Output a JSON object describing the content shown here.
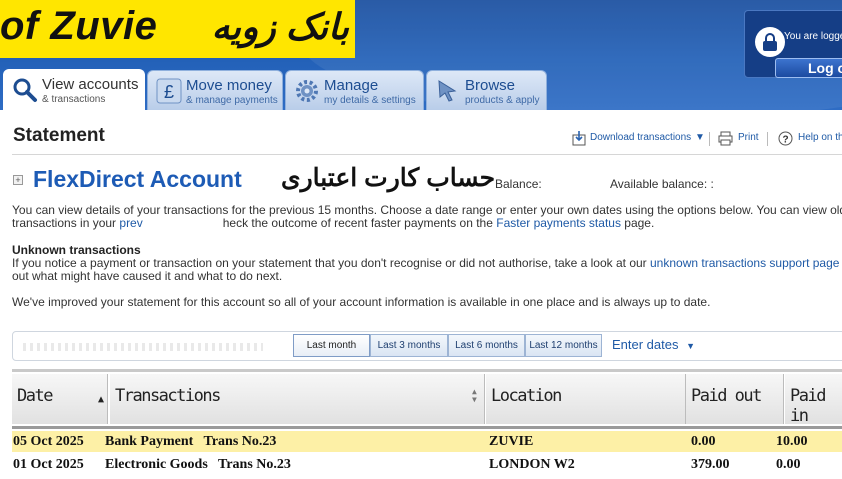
{
  "brand": {
    "name_en": "of Zuvie",
    "name_fa": "بانک زویه"
  },
  "session": {
    "status_text": "You are logge",
    "logout_label": "Log o"
  },
  "tabs": [
    {
      "title": "View accounts",
      "subtitle": "& transactions",
      "icon": "search-icon"
    },
    {
      "title": "Move money",
      "subtitle": "& manage payments",
      "icon": "pound-icon"
    },
    {
      "title": "Manage",
      "subtitle": "my details & settings",
      "icon": "gear-icon"
    },
    {
      "title": "Browse",
      "subtitle": "products & apply",
      "icon": "cursor-icon"
    }
  ],
  "page": {
    "title": "Statement",
    "tools": {
      "download": "Download transactions",
      "print": "Print",
      "help": "Help on th"
    }
  },
  "account": {
    "name": "FlexDirect Account",
    "name_fa": "حساب کارت اعتباری",
    "balance_label": "Balance:",
    "available_label": "Available balance:",
    "available_value": ":"
  },
  "intro": {
    "line1": "You can view details of your transactions for the previous 15 months. Choose a date range or enter your own dates using the options below. You can view older",
    "line2_a": "transactions in your ",
    "line2_link1": "prev",
    "line2_b": "heck the outcome of recent faster payments on the ",
    "line2_link2": "Faster payments status",
    "line2_c": " page."
  },
  "unknown": {
    "heading": "Unknown transactions",
    "line1_a": "If you notice a payment or transaction on your statement that you don't recognise or did not authorise, take a look at our ",
    "line1_link": "unknown transactions support page",
    "line2": "out what might have caused it and what to do next."
  },
  "notice": "We've improved your statement for this account so all of your account information is available in one place and is always up to date.",
  "filters": {
    "ranges": [
      "Last month",
      "Last 3 months",
      "Last 6 months",
      "Last 12 months"
    ],
    "selected": "Last month",
    "enter_dates": "Enter dates"
  },
  "table": {
    "headers": [
      "Date",
      "Transactions",
      "Location",
      "Paid out",
      "Paid in"
    ],
    "rows": [
      {
        "date": "05 Oct 2025",
        "description": "Bank Payment   Trans No.23",
        "location": "ZUVIE",
        "paid_out": "0.00",
        "paid_in": "10.00",
        "highlight": true
      },
      {
        "date": "01 Oct 2025",
        "description": "Electronic Goods   Trans No.23",
        "location": "LONDON W2",
        "paid_out": "379.00",
        "paid_in": "0.00",
        "highlight": false
      }
    ]
  },
  "colors": {
    "header_blue": "#1f56a8",
    "brand_yellow": "#ffe600",
    "link_blue": "#1f5aa6",
    "highlight_row": "#fdf0a6"
  }
}
